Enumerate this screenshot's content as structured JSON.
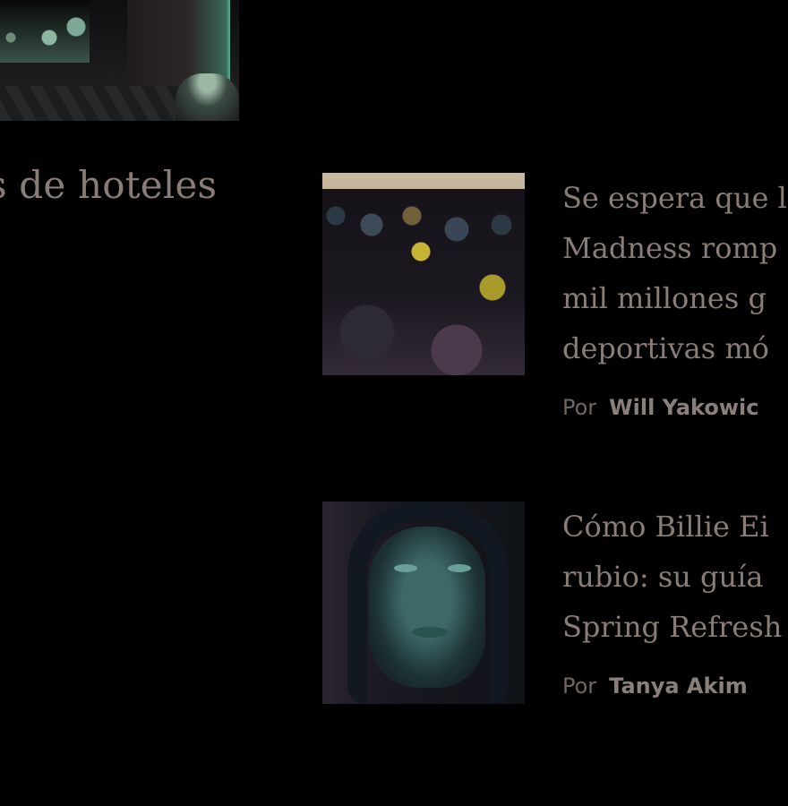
{
  "left_column": {
    "heading": "s de hoteles"
  },
  "articles": [
    {
      "title_lines": [
        "Se espera que l",
        "Madness romp",
        "mil millones g",
        "deportivas mó"
      ],
      "by_label": "Por",
      "author": "Will Yakowic"
    },
    {
      "title_lines": [
        "Cómo Billie Ei",
        "rubio: su guía",
        "Spring Refresh"
      ],
      "by_label": "Por",
      "author": "Tanya Akim"
    }
  ]
}
